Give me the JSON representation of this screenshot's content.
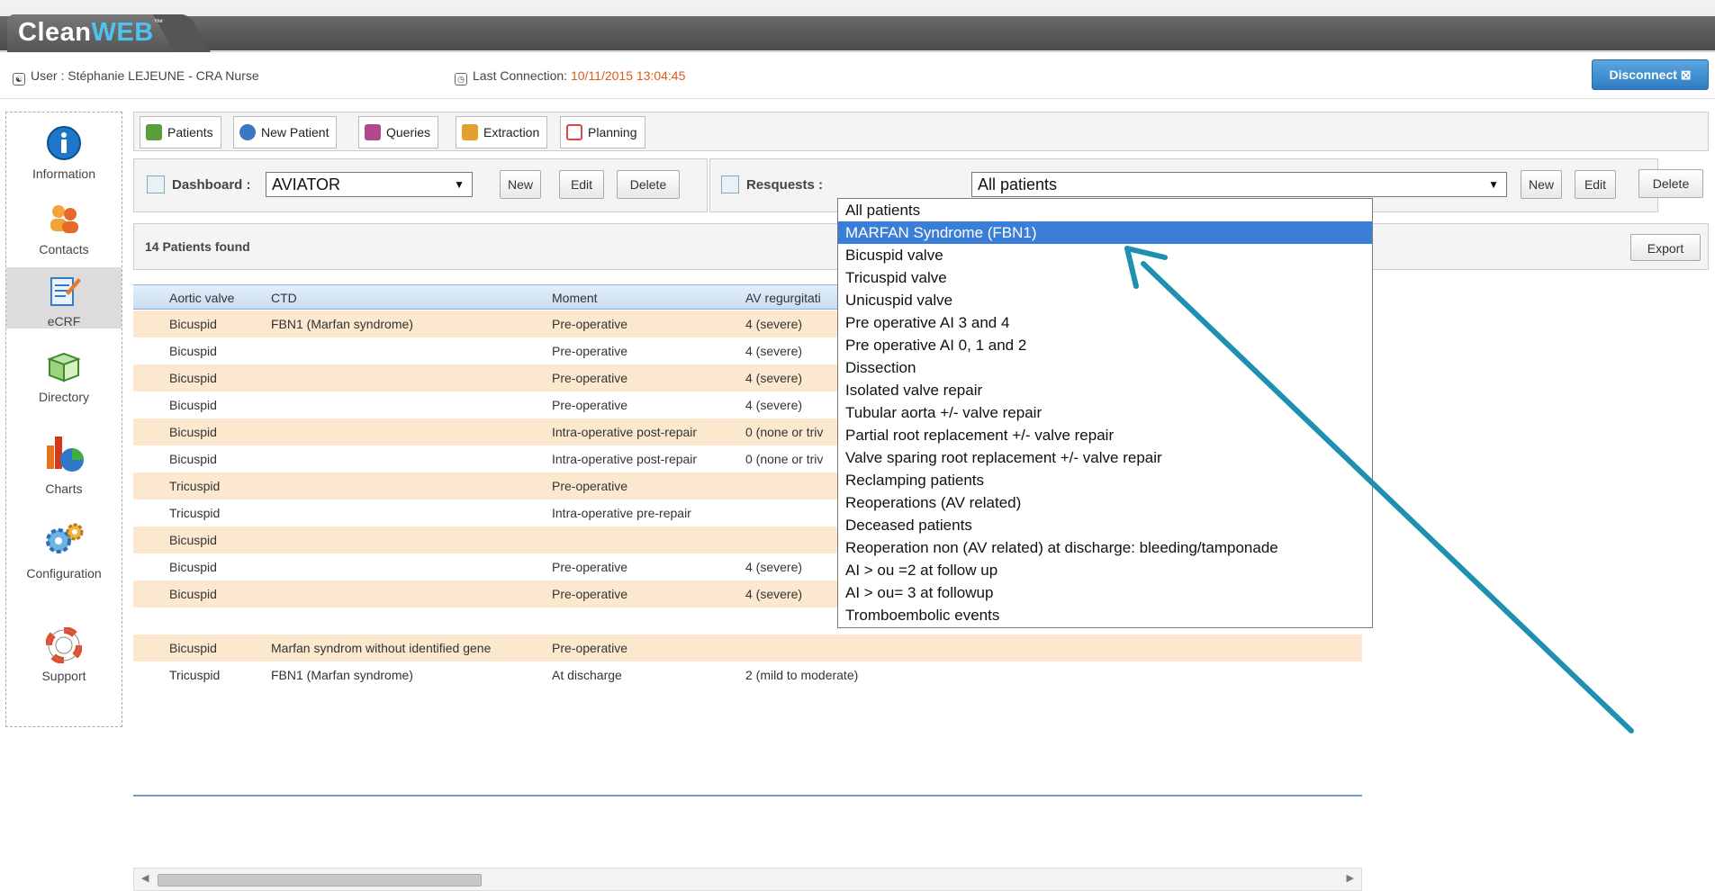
{
  "brand": {
    "name_a": "Clean",
    "name_b": "WEB",
    "tm": "™"
  },
  "userbar": {
    "user": "User : Stéphanie LEJEUNE - CRA Nurse",
    "conn_prefix": "Last Connection: ",
    "conn_date": "10/11/2015 13:04:45",
    "disconnect": "Disconnect ⊠"
  },
  "sidebar": {
    "items": [
      {
        "label": "Information",
        "icon": "info-icon"
      },
      {
        "label": "Contacts",
        "icon": "contacts-icon"
      },
      {
        "label": "eCRF",
        "icon": "ecrf-icon"
      },
      {
        "label": "Directory",
        "icon": "directory-icon"
      },
      {
        "label": "Charts",
        "icon": "charts-icon"
      },
      {
        "label": "Configuration",
        "icon": "gears-icon"
      },
      {
        "label": "Support",
        "icon": "lifebuoy-icon"
      }
    ]
  },
  "tabs": [
    "Patients",
    "New Patient",
    "Queries",
    "Extraction",
    "Planning"
  ],
  "dashboard": {
    "label": "Dashboard :",
    "value": "AVIATOR",
    "new": "New",
    "edit": "Edit",
    "delete": "Delete"
  },
  "requests": {
    "label": "Resquests :",
    "value": "All patients",
    "new": "New",
    "edit": "Edit",
    "delete": "Delete"
  },
  "found": {
    "text": "14 Patients found",
    "export": "Export"
  },
  "table": {
    "headers": [
      "Aortic valve",
      "CTD",
      "Moment",
      "AV regurgitati"
    ],
    "rows": [
      [
        "Bicuspid",
        "FBN1 (Marfan syndrome)",
        "Pre-operative",
        "4 (severe)"
      ],
      [
        "Bicuspid",
        "",
        "Pre-operative",
        "4 (severe)"
      ],
      [
        "Bicuspid",
        "",
        "Pre-operative",
        "4 (severe)"
      ],
      [
        "Bicuspid",
        "",
        "Pre-operative",
        "4 (severe)"
      ],
      [
        "Bicuspid",
        "",
        "Intra-operative post-repair",
        "0 (none or triv"
      ],
      [
        "Bicuspid",
        "",
        "Intra-operative post-repair",
        "0 (none or triv"
      ],
      [
        "Tricuspid",
        "",
        "Pre-operative",
        ""
      ],
      [
        "Tricuspid",
        "",
        "Intra-operative pre-repair",
        ""
      ],
      [
        "Bicuspid",
        "",
        "",
        ""
      ],
      [
        "Bicuspid",
        "",
        "Pre-operative",
        "4 (severe)"
      ],
      [
        "Bicuspid",
        "",
        "Pre-operative",
        "4 (severe)"
      ],
      [
        "",
        "",
        "",
        ""
      ],
      [
        "Bicuspid",
        "Marfan syndrom without identified gene",
        "Pre-operative",
        ""
      ],
      [
        "Tricuspid",
        "FBN1 (Marfan syndrome)",
        "At discharge",
        "2 (mild to moderate)"
      ]
    ]
  },
  "dropdown": {
    "selected_index": 1,
    "options": [
      "All patients",
      "MARFAN Syndrome (FBN1)",
      "Bicuspid valve",
      "Tricuspid valve",
      "Unicuspid valve",
      "Pre operative AI 3 and 4",
      "Pre operative AI 0, 1 and 2",
      "Dissection",
      "Isolated valve repair",
      "Tubular aorta +/- valve repair",
      "Partial root replacement +/- valve repair",
      "Valve sparing root replacement +/- valve repair",
      "Reclamping patients",
      "Reoperations (AV related)",
      "Deceased patients",
      "Reoperation non (AV related) at discharge: bleeding/tamponade",
      "AI > ou =2 at follow up",
      "AI > ou= 3 at followup",
      "Tromboembolic events"
    ]
  },
  "colors": {
    "accent": "#3b7ed8",
    "row_highlight": "#fbe8cf",
    "arrow": "#1e90b0"
  }
}
